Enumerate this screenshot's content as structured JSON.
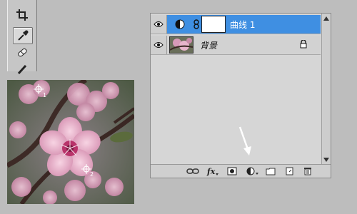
{
  "toolbar": {
    "tools": [
      {
        "icon": "crop-icon",
        "selected": false
      },
      {
        "icon": "eyedropper-icon",
        "selected": true
      },
      {
        "icon": "healing-brush-icon",
        "selected": false
      },
      {
        "icon": "brush-icon",
        "selected": false
      }
    ]
  },
  "canvas": {
    "description_icon": "cherry-blossom-photo",
    "sample_points": [
      "1",
      "2"
    ]
  },
  "layers": {
    "rows": [
      {
        "name": "曲线 1",
        "type": "adjustment",
        "active": true
      },
      {
        "name": "背景",
        "type": "background",
        "active": false,
        "locked": true
      }
    ],
    "footer_buttons": [
      "link-icon",
      "fx",
      "mask-icon",
      "adjustment-icon",
      "folder-icon",
      "new-layer-icon",
      "trash-icon"
    ],
    "fx_label": "fx",
    "accent_color": "#3f8fe2"
  }
}
